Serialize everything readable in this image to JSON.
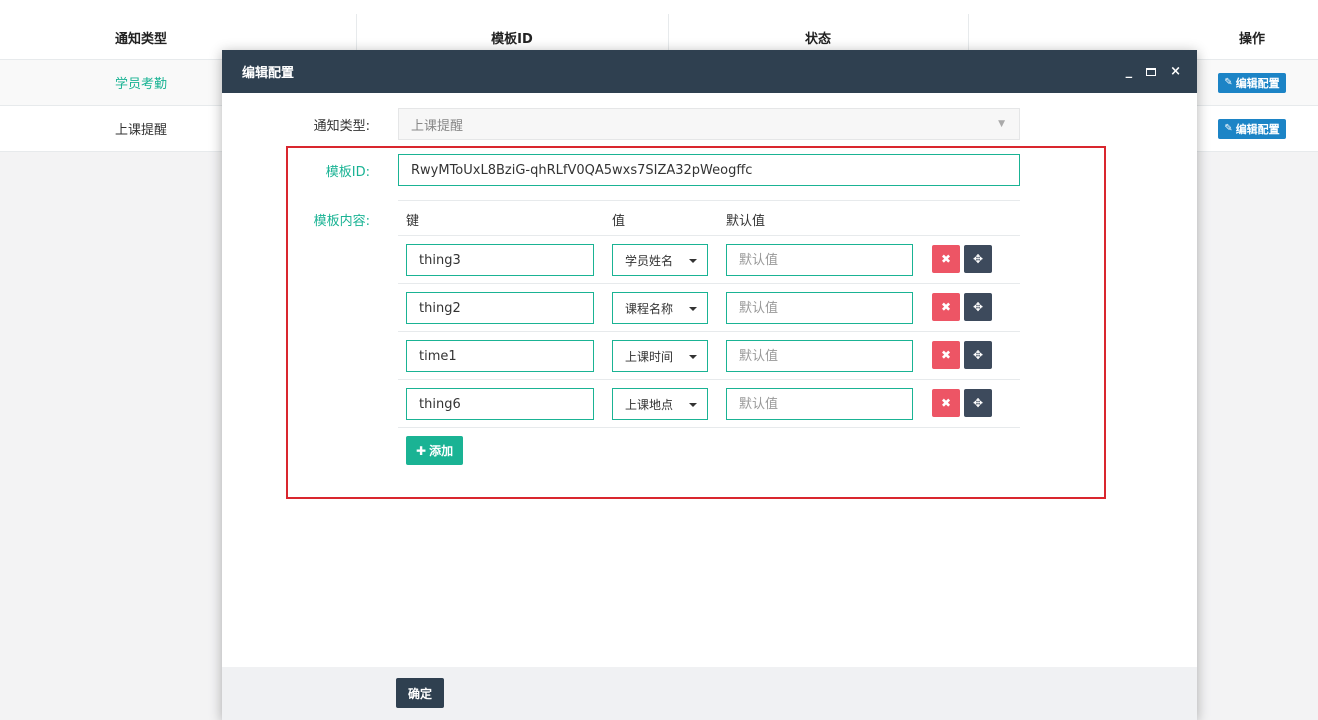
{
  "table": {
    "headers": {
      "type": "通知类型",
      "template_id": "模板ID",
      "status": "状态",
      "operation": "操作"
    },
    "rows": [
      {
        "type": "学员考勤",
        "op_label": "编辑配置"
      },
      {
        "type": "上课提醒",
        "op_label": "编辑配置"
      }
    ]
  },
  "modal": {
    "title": "编辑配置",
    "controls": {
      "minimize": "_",
      "close": "×"
    },
    "notice_type": {
      "label": "通知类型:",
      "value": "上课提醒"
    },
    "template_id": {
      "label": "模板ID:",
      "value": "RwyMToUxL8BziG-qhRLfV0QA5wxs7SIZA32pWeogffc"
    },
    "content": {
      "label": "模板内容:",
      "columns": {
        "key": "键",
        "value": "值",
        "default": "默认值"
      },
      "default_placeholder": "默认值",
      "rows": [
        {
          "key": "thing3",
          "value": "学员姓名"
        },
        {
          "key": "thing2",
          "value": "课程名称"
        },
        {
          "key": "time1",
          "value": "上课时间"
        },
        {
          "key": "thing6",
          "value": "上课地点"
        }
      ]
    },
    "add_label": "添加",
    "ok_label": "确定"
  },
  "colors": {
    "accent": "#1ab394",
    "header": "#2f4050",
    "danger": "#ed5565",
    "primary": "#1c84c6",
    "highlight": "#d9262e"
  }
}
